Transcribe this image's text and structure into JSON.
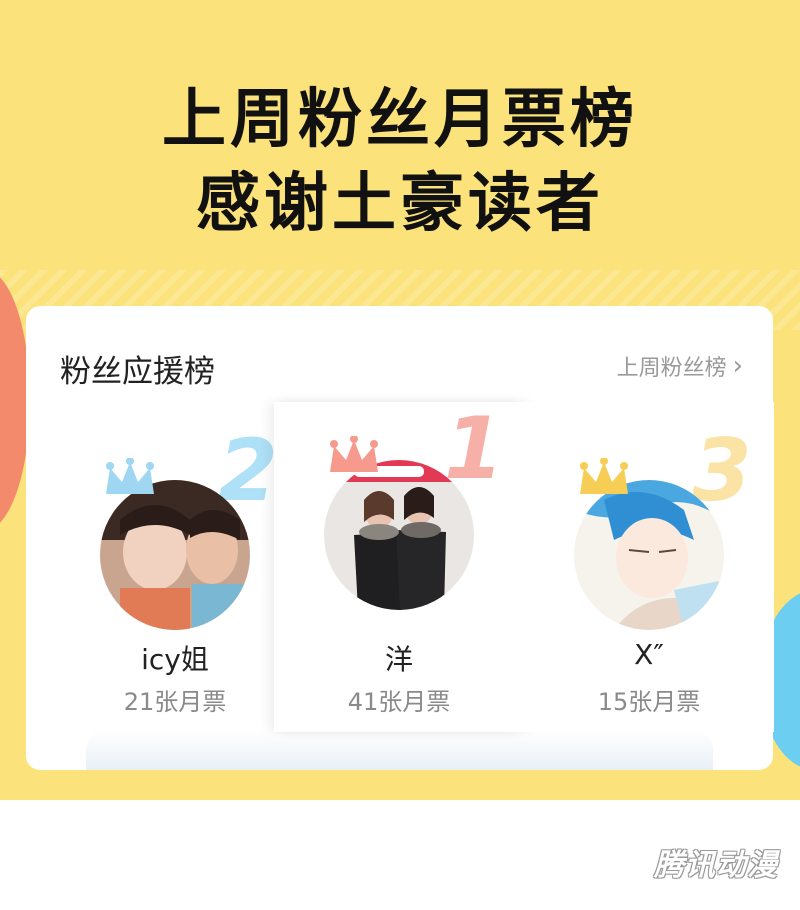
{
  "headline": {
    "line1": "上周粉丝月票榜",
    "line2": "感谢土豪读者"
  },
  "card": {
    "title": "粉丝应援榜",
    "link_label": "上周粉丝榜"
  },
  "fans": [
    {
      "rank": "2",
      "name": "icy姐",
      "votes": "21张月票",
      "accent": "#aee0f7",
      "crown_color": "#9fd6f2"
    },
    {
      "rank": "1",
      "name": "洋",
      "votes": "41张月票",
      "accent": "#f7b0a7",
      "crown_color": "#f59a8c"
    },
    {
      "rank": "3",
      "name": "X″",
      "votes": "15张月票",
      "accent": "#fbe3a6",
      "crown_color": "#f6cd55"
    }
  ],
  "watermark": "腾讯动漫",
  "colors": {
    "banner": "#fbe27a",
    "blob_left": "#f48a6c",
    "blob_right": "#6ccff2"
  }
}
